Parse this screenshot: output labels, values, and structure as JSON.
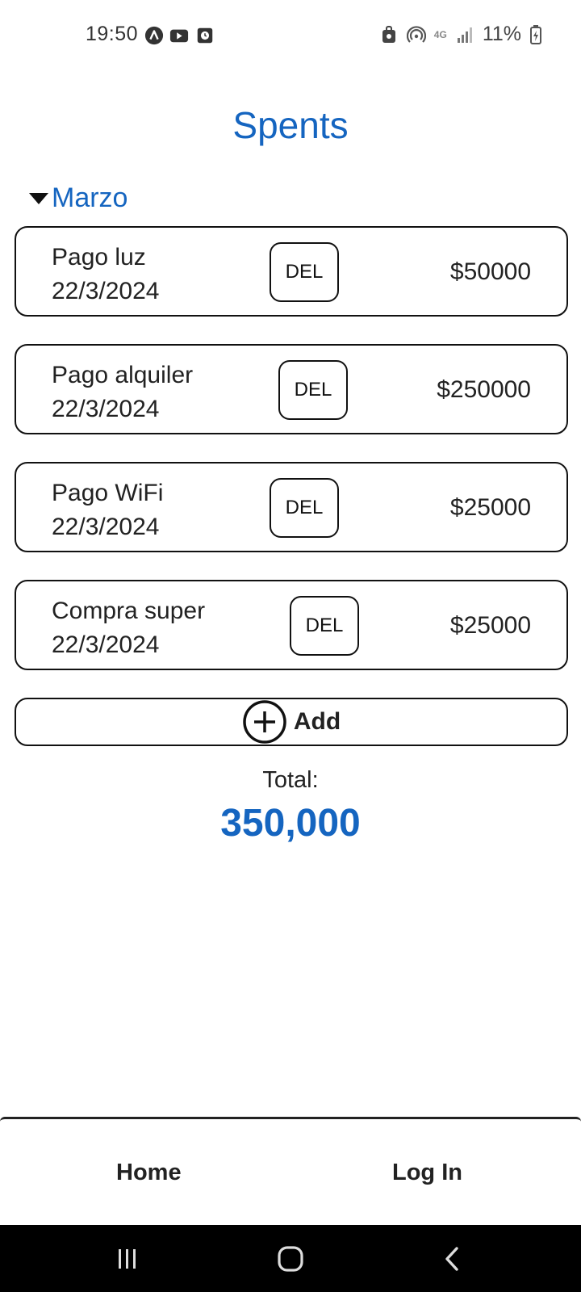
{
  "status_bar": {
    "time": "19:50",
    "battery_pct": "11%",
    "network": "4G",
    "left_icons": [
      "app-a-icon",
      "youtube-icon",
      "clock-app-icon"
    ],
    "right_icons": [
      "vpn-lock-icon",
      "hotspot-icon",
      "network-4g-icon",
      "signal-icon",
      "battery-charging-icon"
    ]
  },
  "page": {
    "title": "Spents"
  },
  "section": {
    "label": "Marzo",
    "expanded": true
  },
  "expenses": [
    {
      "name": "Pago luz",
      "date": "22/3/2024",
      "del_label": "DEL",
      "amount": "$50000"
    },
    {
      "name": "Pago alquiler",
      "date": "22/3/2024",
      "del_label": "DEL",
      "amount": "$250000"
    },
    {
      "name": "Pago WiFi",
      "date": "22/3/2024",
      "del_label": "DEL",
      "amount": "$25000"
    },
    {
      "name": "Compra super",
      "date": "22/3/2024",
      "del_label": "DEL",
      "amount": "$25000"
    }
  ],
  "add": {
    "label": "Add",
    "icon": "plus-circle-icon"
  },
  "total": {
    "label": "Total:",
    "value": "350,000"
  },
  "tabs": {
    "home": "Home",
    "login": "Log In"
  },
  "system_nav": [
    "recents-icon",
    "home-icon",
    "back-icon"
  ],
  "colors": {
    "accent": "#1565c0",
    "text": "#222222",
    "border": "#111111",
    "nav_background": "#000000"
  }
}
